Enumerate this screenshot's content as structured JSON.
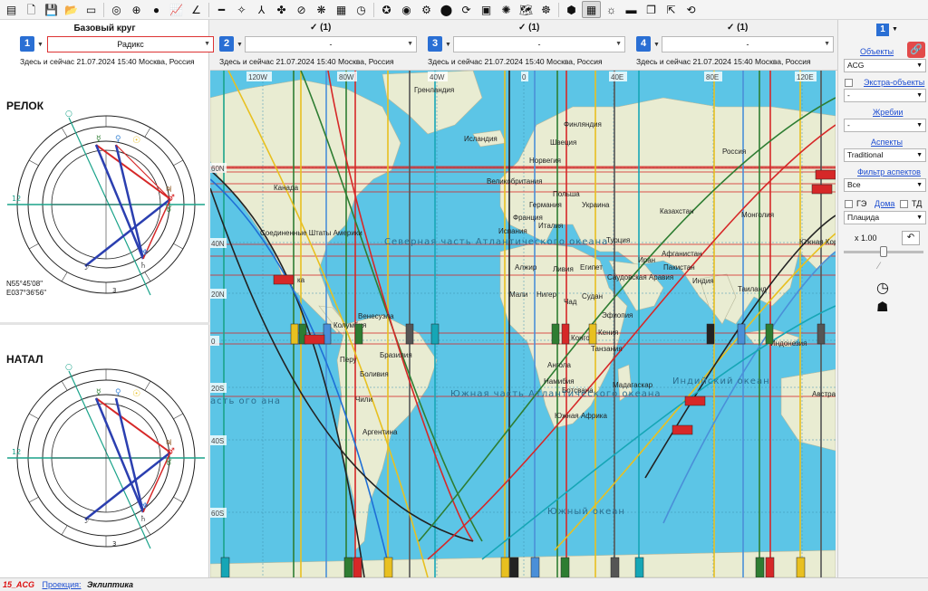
{
  "toolbar": {
    "icons": [
      "db-icon",
      "new-icon",
      "save-icon",
      "open-folder-icon",
      "print-icon",
      "wheel-icon",
      "globe-icon",
      "moon-icon",
      "graph-icon",
      "angle-icon",
      "ruler-icon",
      "sparkle-icon",
      "axis-icon",
      "clover-icon",
      "compass-icon",
      "ephemeris-icon",
      "calendar-icon",
      "clock-icon",
      "astrologer-icon",
      "eye-icon",
      "gear-icon",
      "record-icon",
      "refresh-icon",
      "book-icon",
      "target-icon",
      "map-icon",
      "settings-icon",
      "planets-icon",
      "grid-icon",
      "sun-icon",
      "camera-icon",
      "layers-icon",
      "export-icon",
      "forward-icon"
    ],
    "glyphs": [
      "▤",
      "🗋",
      "💾",
      "📂",
      "▭",
      "◎",
      "⊕",
      "●",
      "📈",
      "∠",
      "━",
      "✧",
      "⅄",
      "✤",
      "⊘",
      "❋",
      "▦",
      "◷",
      "✪",
      "◉",
      "⚙",
      "⬤",
      "⟳",
      "▣",
      "✺",
      "🗺",
      "☸",
      "⬢",
      "▦",
      "☼",
      "▬",
      "❐",
      "⇱",
      "⟲"
    ]
  },
  "left": {
    "title": "Базовый круг",
    "relok_label": "РЕЛОК",
    "natal_label": "НАТАЛ",
    "coord_lat": "N55°45'08\"",
    "coord_lon": "E037°36'56\""
  },
  "slots": [
    {
      "num": "1",
      "value": "Радикс",
      "check": "",
      "sub": "Здесь и сейчас 21.07.2024 15:40 Москва, Россия"
    },
    {
      "num": "2",
      "value": "-",
      "check": "✓ (1)",
      "sub": "Здесь и сейчас 21.07.2024 15:40 Москва, Россия"
    },
    {
      "num": "3",
      "value": "-",
      "check": "✓ (1)",
      "sub": "Здесь и сейчас 21.07.2024 15:40 Москва, Россия"
    },
    {
      "num": "4",
      "value": "-",
      "check": "✓ (1)",
      "sub": "Здесь и сейчас 21.07.2024 15:40 Москва, Россия"
    }
  ],
  "map": {
    "grid_top": [
      "120W",
      "80W",
      "40W",
      "0",
      "40E",
      "80E",
      "120E"
    ],
    "grid_left": [
      "60N",
      "40N",
      "20N",
      "0",
      "20S",
      "40S",
      "60S"
    ],
    "labels": {
      "greenland": "Гренландия",
      "iceland": "Исландия",
      "finland": "Финляндия",
      "sweden": "Швеция",
      "norway": "Норвегия",
      "russia": "Россия",
      "gb": "Великобритания",
      "poland": "Польша",
      "germany": "Германия",
      "ukraine": "Украина",
      "france": "Франция",
      "spain": "Испания",
      "italy": "Италия",
      "kazakhstan": "Казахстан",
      "mongolia": "Монголия",
      "turkey": "Турция",
      "canada": "Канада",
      "usa": "Соединенные Штаты Америки",
      "algeria": "Алжир",
      "libya": "Ливия",
      "egypt": "Египет",
      "saudi": "Саудовская Аравия",
      "iran": "Иран",
      "afghanistan": "Афганистан",
      "pakistan": "Пакистан",
      "india": "Индия",
      "thailand": "Таиланд",
      "south_korea": "Южная Корея",
      "mali": "Мали",
      "niger": "Нигер",
      "chad": "Чад",
      "sudan": "Судан",
      "ethiopia": "Эфиопия",
      "kenya": "Кения",
      "tanzania": "Танзания",
      "congo": "Конго",
      "angola": "Ангола",
      "namibia": "Намибия",
      "botswana": "Ботсвана",
      "south_africa": "Южная Африка",
      "madagascar": "Мадагаскар",
      "venezuela": "Венесуэла",
      "colombia": "Колумбия",
      "peru": "Перу",
      "brazil": "Бразилия",
      "bolivia": "Боливия",
      "chile": "Чили",
      "argentina": "Аргентина",
      "indonesia": "Индонезия",
      "australia": "Австра",
      "ka": "ка",
      "n_atlantic": "Северная часть Атлантического океана",
      "s_atlantic": "Южная часть Атлантического океана",
      "indian": "Индийский океан",
      "southern": "Южный океан",
      "pacific_frag": "асть ого ана"
    },
    "line_colors": {
      "sun": "#e8c020",
      "moon": "#222222",
      "mercury": "#2e7d32",
      "venus": "#4a8fd8",
      "mars": "#d62828",
      "jupiter": "#8a4f14",
      "saturn": "#555555",
      "uranus": "#16a6b6",
      "neptune": "#1e6fd6",
      "pluto": "#7a3ea0"
    }
  },
  "right": {
    "slot_num": "1",
    "objects_link": "Объекты",
    "objects_value": "ACG",
    "extra_link": "Экстра-объекты",
    "extra_value": "-",
    "lots_link": "Жребии",
    "lots_value": "-",
    "aspects_link": "Аспекты",
    "aspects_value": "Traditional",
    "filter_link": "Фильтр аспектов",
    "filter_value": "Все",
    "ge_label": "ГЭ",
    "houses_link": "Дома",
    "td_label": "ТД",
    "houses_value": "Плацида",
    "zoom_value": "x 1.00"
  },
  "status": {
    "id": "15_ACG",
    "projection_link": "Проекция:",
    "projection_value": "Эклиптика"
  }
}
